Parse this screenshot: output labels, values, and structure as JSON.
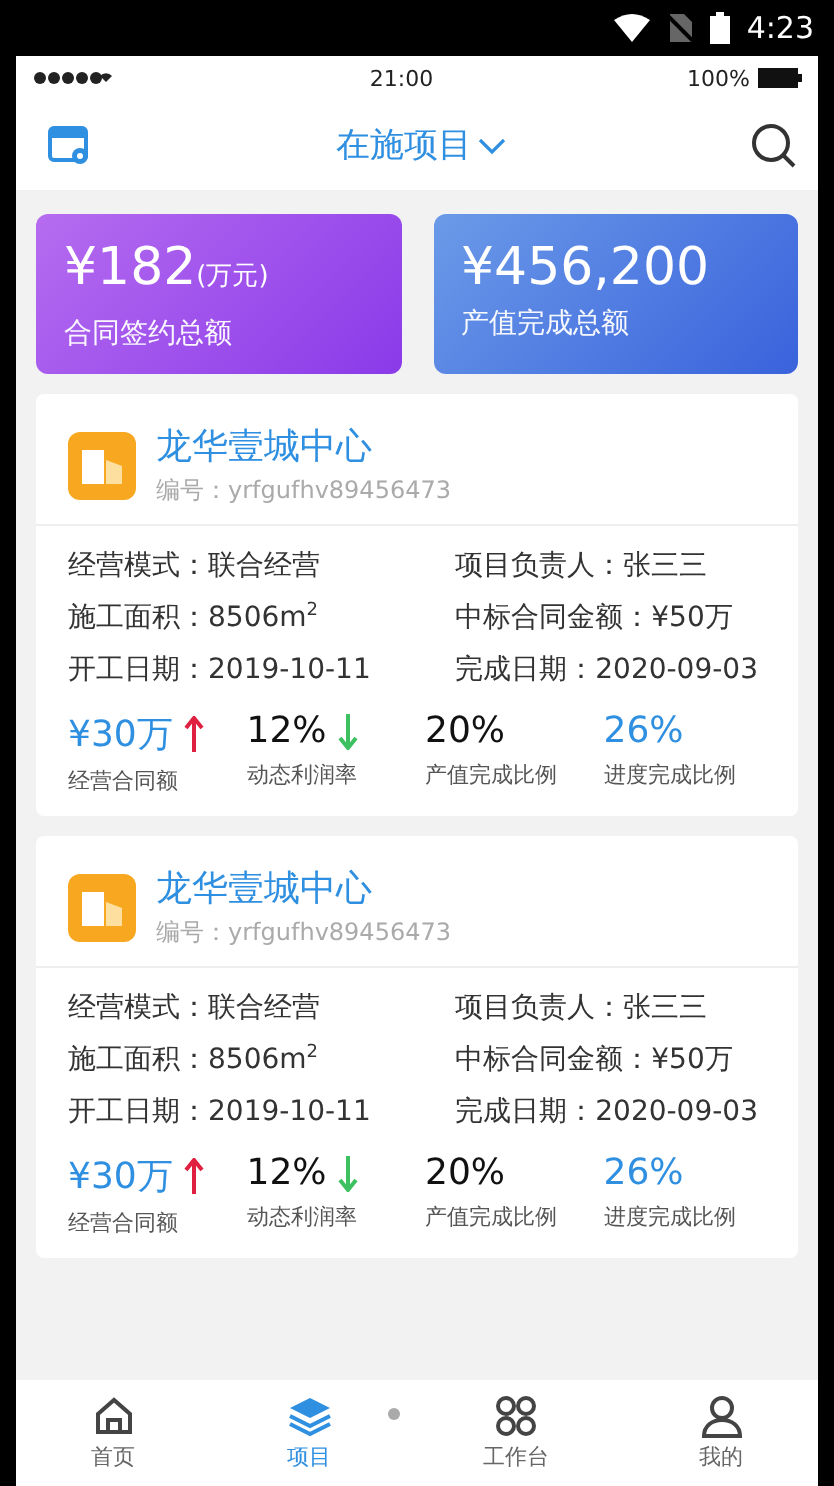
{
  "android_status": {
    "time": "4:23"
  },
  "ios_status": {
    "time": "21:00",
    "battery": "100%"
  },
  "header": {
    "title": "在施项目"
  },
  "summary": [
    {
      "value": "¥182",
      "unit": "(万元)",
      "label": "合同签约总额",
      "kind": "purple"
    },
    {
      "value": "¥456,200",
      "label": "产值完成总额",
      "kind": "blue"
    }
  ],
  "projects": [
    {
      "name": "龙华壹城中心",
      "code": "编号：yrfgufhv89456473",
      "fields": [
        {
          "label": "经营模式：",
          "value": "联合经营"
        },
        {
          "label": "项目负责人：",
          "value": "张三三"
        },
        {
          "label": "施工面积：",
          "value": "8506m$^{2}$"
        },
        {
          "label": "中标合同金额：",
          "value": "¥50万"
        },
        {
          "label": "开工日期：",
          "value": "2019-10-11"
        },
        {
          "label": "完成日期：",
          "value": "2020-09-03"
        }
      ],
      "metrics": [
        {
          "value": "¥30万",
          "label": "经营合同额",
          "accent": true,
          "kind": "rising"
        },
        {
          "value": "12%",
          "label": "动态利润率",
          "accent": false,
          "kind": "falling"
        },
        {
          "value": "20%",
          "label": "产值完成比例",
          "accent": false,
          "kind": "plain"
        },
        {
          "value": "26%",
          "label": "进度完成比例",
          "accent": true,
          "kind": "plain"
        }
      ]
    },
    {
      "name": "龙华壹城中心",
      "code": "编号：yrfgufhv89456473",
      "fields": [
        {
          "label": "经营模式：",
          "value": "联合经营"
        },
        {
          "label": "项目负责人：",
          "value": "张三三"
        },
        {
          "label": "施工面积：",
          "value": "8506m$^{2}$"
        },
        {
          "label": "中标合同金额：",
          "value": "¥50万"
        },
        {
          "label": "开工日期：",
          "value": "2019-10-11"
        },
        {
          "label": "完成日期：",
          "value": "2020-09-03"
        }
      ],
      "metrics": [
        {
          "value": "¥30万",
          "label": "经营合同额",
          "accent": true,
          "kind": "rising"
        },
        {
          "value": "12%",
          "label": "动态利润率",
          "accent": false,
          "kind": "falling"
        },
        {
          "value": "20%",
          "label": "产值完成比例",
          "accent": false,
          "kind": "plain"
        },
        {
          "value": "26%",
          "label": "进度完成比例",
          "accent": true,
          "kind": "plain"
        }
      ]
    }
  ],
  "tabs": [
    {
      "label": "首页",
      "selected": false
    },
    {
      "label": "项目",
      "selected": true
    },
    {
      "label": "工作台",
      "selected": false
    },
    {
      "label": "我的",
      "selected": false
    }
  ]
}
